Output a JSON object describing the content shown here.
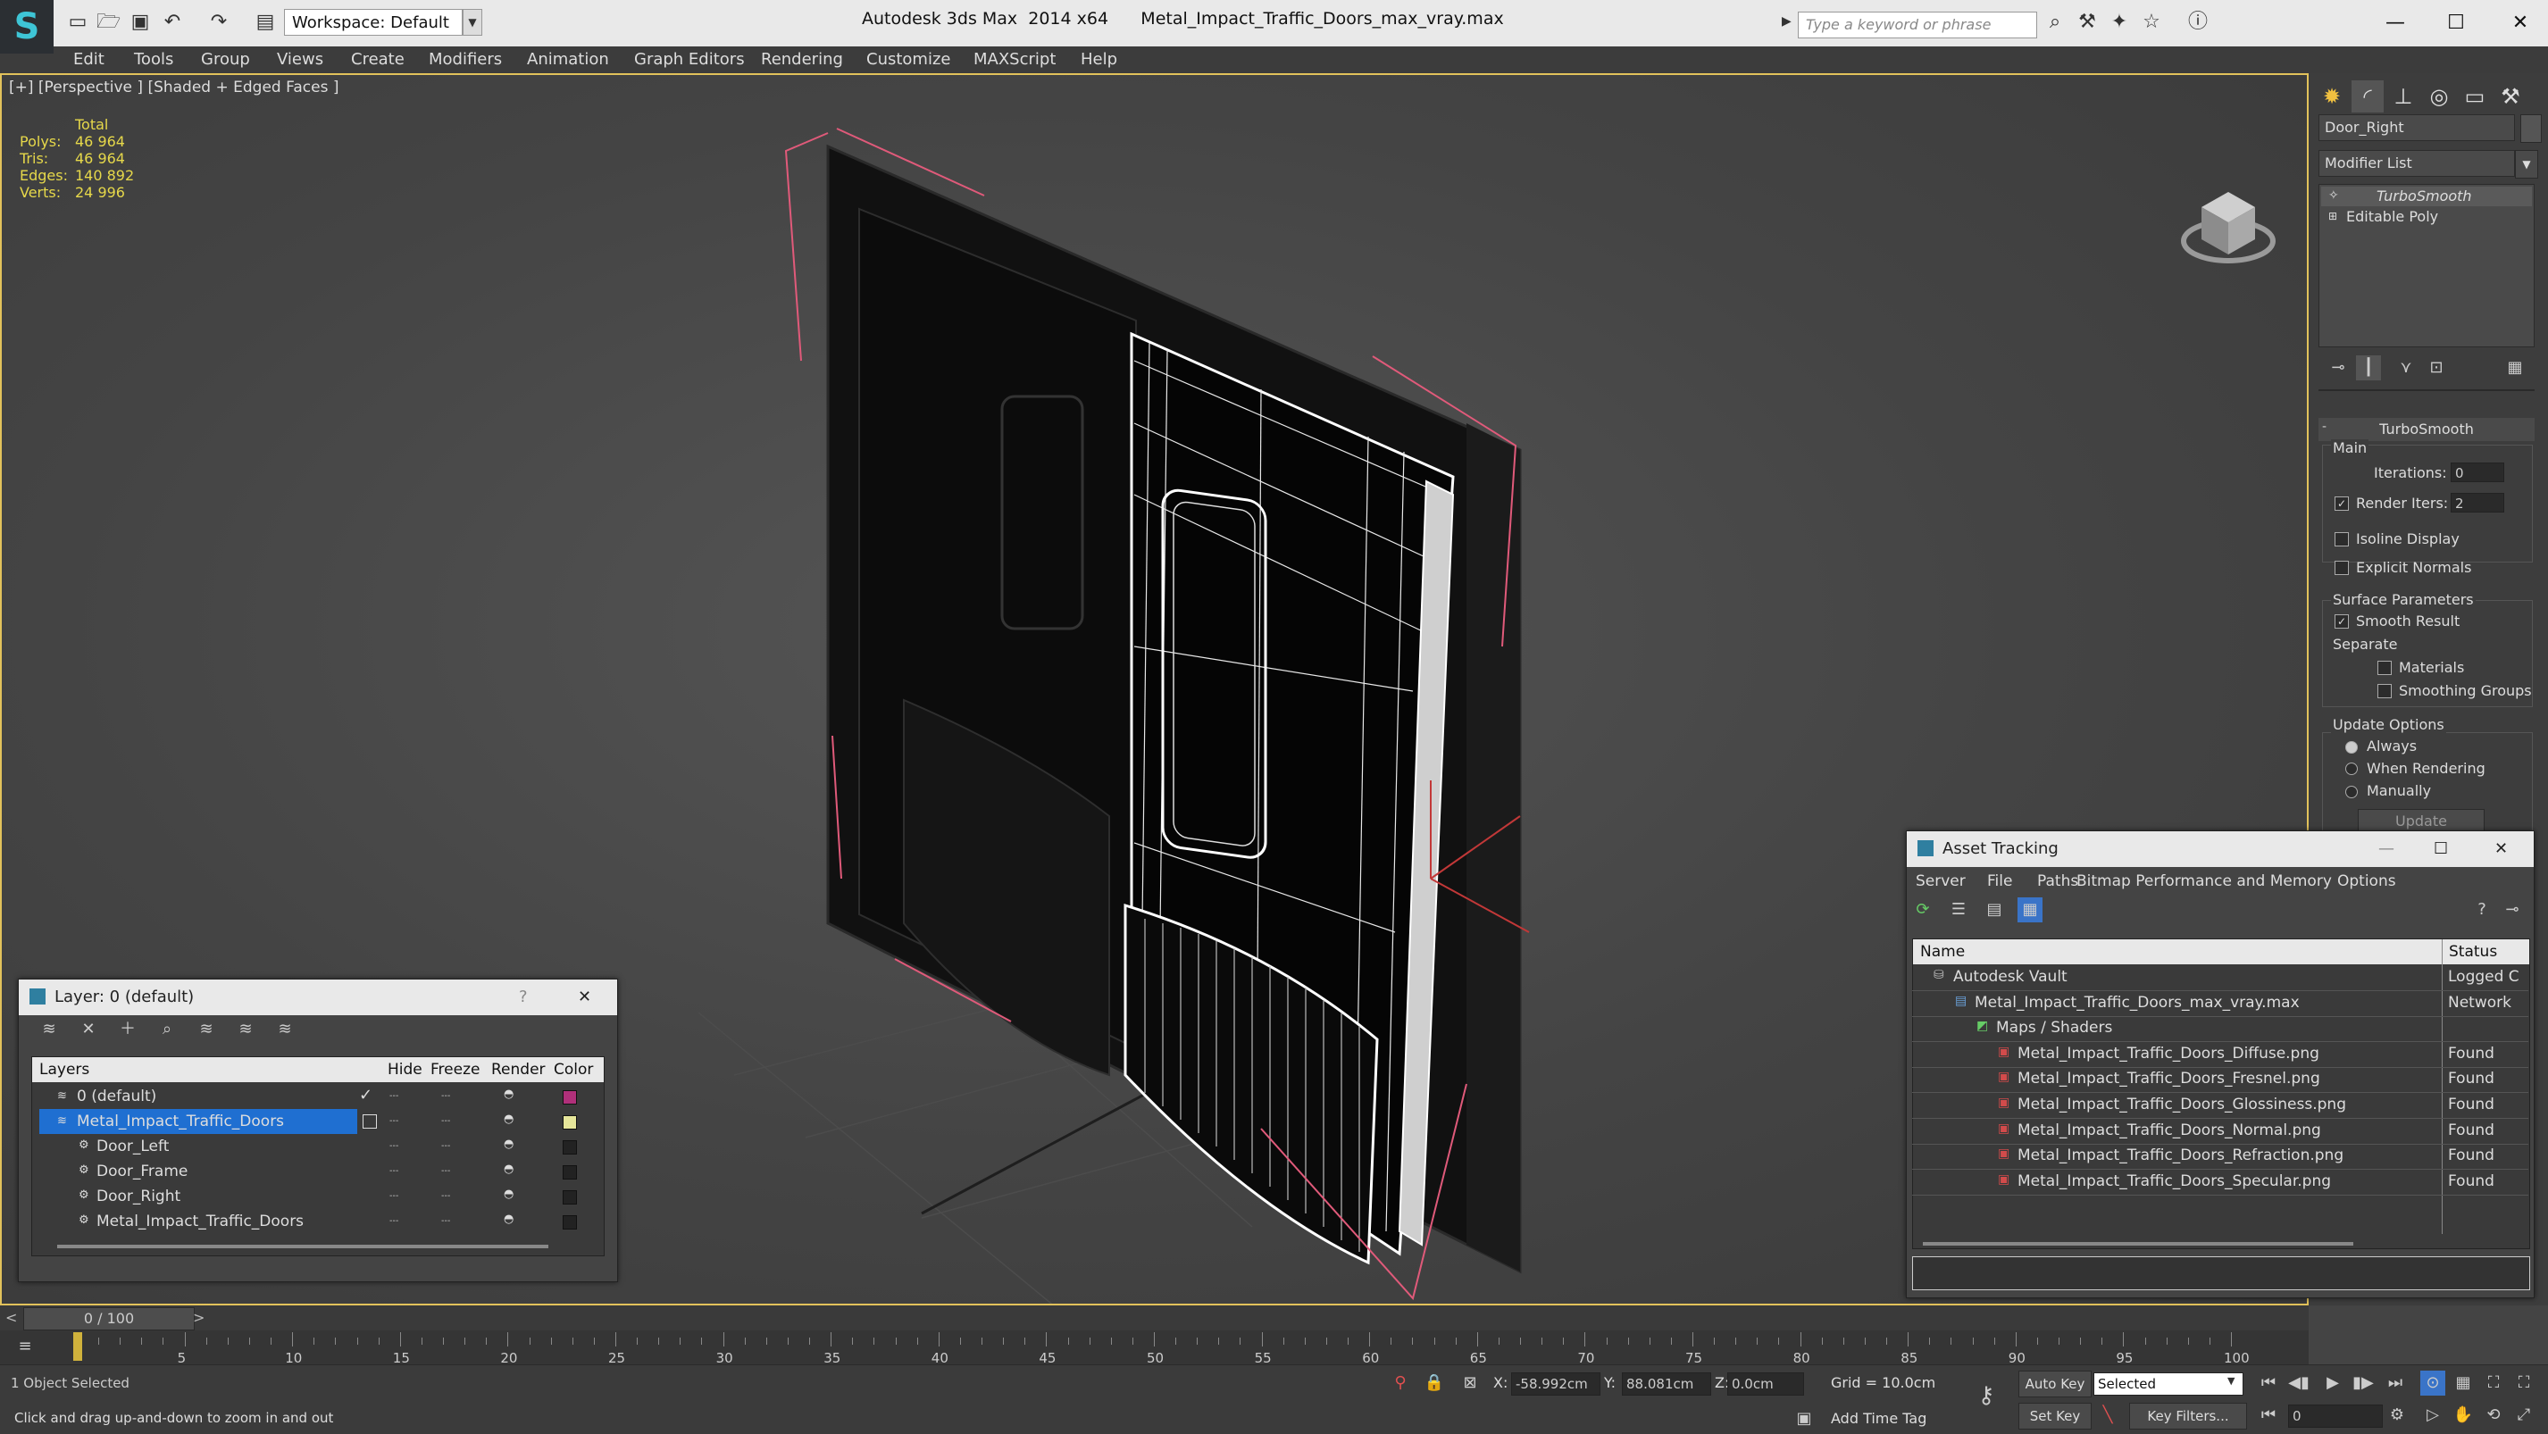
{
  "titlebar": {
    "app_title": "Autodesk 3ds Max  2014 x64      Metal_Impact_Traffic_Doors_max_vray.max",
    "workspace": "Workspace: Default",
    "search_placeholder": "Type a keyword or phrase",
    "icons": [
      "new-icon",
      "open-icon",
      "save-icon",
      "undo-icon",
      "redo-icon",
      "project-icon"
    ],
    "right_icons": [
      "binoculars-icon",
      "tools-icon",
      "favorites-icon",
      "star-icon",
      "help-icon"
    ],
    "window_controls": [
      "minimize-icon",
      "maximize-icon",
      "close-icon"
    ]
  },
  "menubar": {
    "items": [
      "Edit",
      "Tools",
      "Group",
      "Views",
      "Create",
      "Modifiers",
      "Animation",
      "Graph Editors",
      "Rendering",
      "Customize",
      "MAXScript",
      "Help"
    ]
  },
  "viewport": {
    "label": "[+] [Perspective ] [Shaded + Edged Faces ]",
    "stats": {
      "header": "Total",
      "rows": [
        {
          "label": "Polys:",
          "value": "46 964"
        },
        {
          "label": "Tris:",
          "value": "46 964"
        },
        {
          "label": "Edges:",
          "value": "140 892"
        },
        {
          "label": "Verts:",
          "value": "24 996"
        }
      ]
    },
    "border_color": "#e2c25b",
    "selection_color": "#e05a7a"
  },
  "command_panel": {
    "tabs": [
      "create-icon",
      "modify-icon",
      "hierarchy-icon",
      "motion-icon",
      "display-icon",
      "utilities-icon"
    ],
    "object_name": "Door_Right",
    "modifier_list": "Modifier List",
    "stack": [
      "TurboSmooth",
      "Editable Poly"
    ],
    "stack_tools": [
      "pin-stack-icon",
      "show-end-result-icon",
      "make-unique-icon",
      "remove-modifier-icon",
      "configure-sets-icon"
    ],
    "turbosmooth": {
      "title": "TurboSmooth",
      "main": "Main",
      "iterations_label": "Iterations:",
      "iterations": "0",
      "render_iters_label": "Render Iters:",
      "render_iters": "2",
      "isoline": "Isoline Display",
      "explicit_normals": "Explicit Normals",
      "surface_params": "Surface Parameters",
      "smooth_result": "Smooth Result",
      "separate": "Separate",
      "materials": "Materials",
      "smoothing_groups": "Smoothing Groups",
      "update_options": "Update Options",
      "always": "Always",
      "when_rendering": "When Rendering",
      "manually": "Manually",
      "update_button": "Update"
    }
  },
  "layer_window": {
    "title": "Layer: 0 (default)",
    "help": "?",
    "toolbar": [
      "create-layer-icon",
      "delete-layer-icon",
      "add-to-layer-icon",
      "select-objects-icon",
      "highlight-layer-icon",
      "hide-all-icon",
      "freeze-all-icon"
    ],
    "columns": [
      "Layers",
      "Hide",
      "Freeze",
      "Render",
      "Color"
    ],
    "rows": [
      {
        "name": "0 (default)",
        "color": "#b0307a",
        "indent": 0,
        "active": true
      },
      {
        "name": "Metal_Impact_Traffic_Doors",
        "color": "#e6e69a",
        "indent": 0,
        "selected": true
      },
      {
        "name": "Door_Left",
        "color": "#222222",
        "indent": 1
      },
      {
        "name": "Door_Frame",
        "color": "#222222",
        "indent": 1
      },
      {
        "name": "Door_Right",
        "color": "#222222",
        "indent": 1
      },
      {
        "name": "Metal_Impact_Traffic_Doors",
        "color": "#222222",
        "indent": 1
      }
    ]
  },
  "asset_window": {
    "title": "Asset Tracking",
    "menu": [
      "Server",
      "File",
      "Paths",
      "Bitmap Performance and Memory",
      "Options"
    ],
    "toolbar": [
      "refresh-icon",
      "list-icon",
      "thumbnail-icon",
      "table-icon"
    ],
    "columns": [
      "Name",
      "Status"
    ],
    "rows": [
      {
        "name": "Autodesk Vault",
        "status": "Logged C",
        "indent": 1,
        "icon": "vault-icon"
      },
      {
        "name": "Metal_Impact_Traffic_Doors_max_vray.max",
        "status": "Network",
        "indent": 2,
        "icon": "max-file-icon"
      },
      {
        "name": "Maps / Shaders",
        "status": "",
        "indent": 3,
        "icon": "maps-icon"
      },
      {
        "name": "Metal_Impact_Traffic_Doors_Diffuse.png",
        "status": "Found",
        "indent": 4,
        "icon": "png-icon"
      },
      {
        "name": "Metal_Impact_Traffic_Doors_Fresnel.png",
        "status": "Found",
        "indent": 4,
        "icon": "png-icon"
      },
      {
        "name": "Metal_Impact_Traffic_Doors_Glossiness.png",
        "status": "Found",
        "indent": 4,
        "icon": "png-icon"
      },
      {
        "name": "Metal_Impact_Traffic_Doors_Normal.png",
        "status": "Found",
        "indent": 4,
        "icon": "png-icon"
      },
      {
        "name": "Metal_Impact_Traffic_Doors_Refraction.png",
        "status": "Found",
        "indent": 4,
        "icon": "png-icon"
      },
      {
        "name": "Metal_Impact_Traffic_Doors_Specular.png",
        "status": "Found",
        "indent": 4,
        "icon": "png-icon"
      }
    ]
  },
  "timeline": {
    "frame_display": "0 / 100",
    "prev": "<",
    "next": ">",
    "ticks": [
      "5",
      "10",
      "15",
      "20",
      "25",
      "30",
      "35",
      "40",
      "45",
      "50",
      "55",
      "60",
      "65",
      "70",
      "75",
      "80",
      "85",
      "90",
      "95",
      "100"
    ]
  },
  "statusbar": {
    "selection": "1 Object Selected",
    "prompt": "Click and drag up-and-down to zoom in and out",
    "x_label": "X:",
    "x_value": "-58.992cm",
    "y_label": "Y:",
    "y_value": "88.081cm",
    "z_label": "Z:",
    "z_value": "0.0cm",
    "grid": "Grid = 10.0cm",
    "add_time_tag": "Add Time Tag",
    "auto_key": "Auto Key",
    "auto_key_dd": "Selected",
    "set_key": "Set Key",
    "key_filters": "Key Filters...",
    "frame": "0"
  }
}
